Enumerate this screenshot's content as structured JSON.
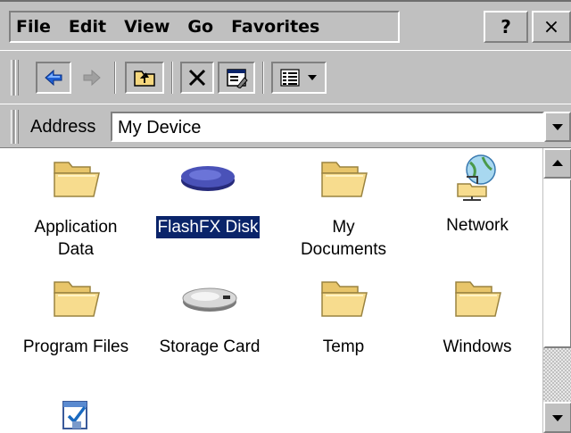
{
  "menu": {
    "items": [
      "File",
      "Edit",
      "View",
      "Go",
      "Favorites"
    ],
    "help_label": "?",
    "close_label": "×"
  },
  "toolbar": {
    "buttons": [
      "back-arrow-icon",
      "forward-arrow-icon",
      "up-folder-icon",
      "delete-icon",
      "properties-icon",
      "views-icon"
    ]
  },
  "address": {
    "label": "Address",
    "value": "My Device"
  },
  "items": [
    {
      "label": "Application Data",
      "label_lines": [
        "Application",
        "Data"
      ],
      "icon": "folder-icon",
      "selected": false
    },
    {
      "label": "FlashFX Disk",
      "label_lines": [
        "FlashFX Disk"
      ],
      "icon": "flash-disk-icon",
      "selected": true
    },
    {
      "label": "My Documents",
      "label_lines": [
        "My",
        "Documents"
      ],
      "icon": "folder-icon",
      "selected": false
    },
    {
      "label": "Network",
      "label_lines": [
        "Network"
      ],
      "icon": "network-icon",
      "selected": false
    },
    {
      "label": "Program Files",
      "label_lines": [
        "Program Files"
      ],
      "icon": "folder-icon",
      "selected": false
    },
    {
      "label": "Storage Card",
      "label_lines": [
        "Storage Card"
      ],
      "icon": "storage-card-icon",
      "selected": false
    },
    {
      "label": "Temp",
      "label_lines": [
        "Temp"
      ],
      "icon": "folder-icon",
      "selected": false
    },
    {
      "label": "Windows",
      "label_lines": [
        "Windows"
      ],
      "icon": "folder-icon",
      "selected": false
    },
    {
      "label": "",
      "label_lines": [],
      "icon": "control-panel-icon",
      "selected": false
    }
  ],
  "colors": {
    "chrome": "#c0c0c0",
    "selection": "#0a246a",
    "folder": "#f5d77e",
    "window_border": "#6e6e6e"
  }
}
